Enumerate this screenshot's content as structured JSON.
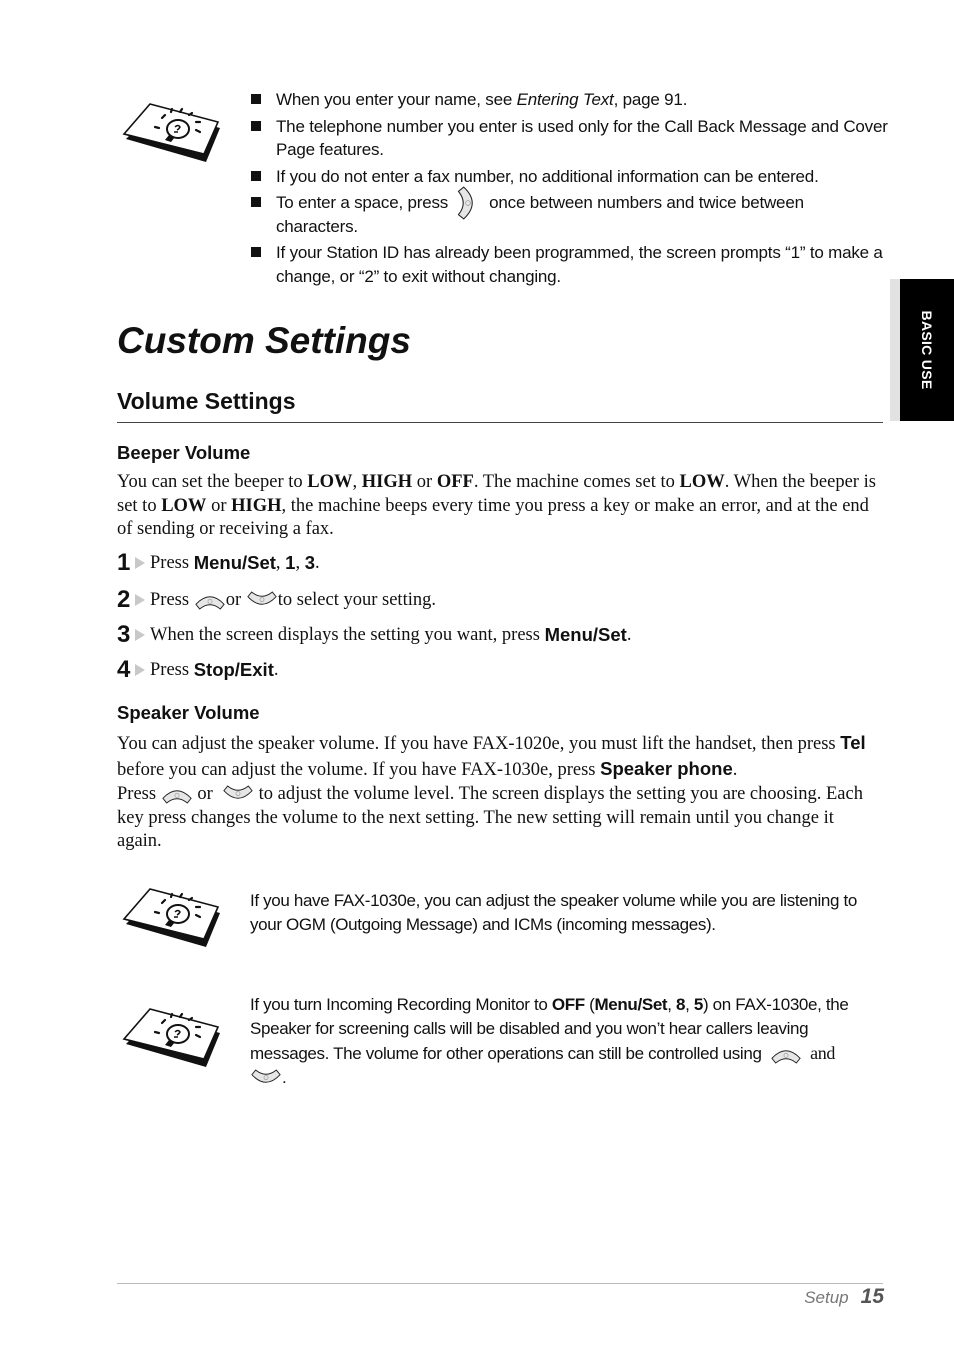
{
  "side_tab": {
    "label": "BASIC USE"
  },
  "notes_top": {
    "bullets": [
      {
        "pre": "When you enter your name, see ",
        "italic": "Entering Text",
        "post": ", page 91."
      },
      {
        "text": "The telephone number you enter is used only for the Call Back Message and Cover Page features."
      },
      {
        "text": "If you do not enter a fax number, no additional information can be entered."
      },
      {
        "pre": "To enter a space, press ",
        "post": " once between numbers and twice between characters."
      },
      {
        "text": "If your Station ID has already been programmed, the screen prompts “1” to make a change, or “2” to exit without changing."
      }
    ]
  },
  "page_title": "Custom Settings",
  "section": {
    "title": "Volume Settings",
    "beeper": {
      "title": "Beeper Volume",
      "intro": {
        "p1": "You can set the beeper to ",
        "low": "LOW",
        "c1": ", ",
        "high": "HIGH",
        "or": " or ",
        "off": "OFF",
        "p2": ". The machine comes set to ",
        "low2": "LOW",
        "p3": ". When the beeper is set to ",
        "low3": "LOW",
        "or2": " or ",
        "high2": "HIGH",
        "p4": ", the machine beeps every time you press a key or make an error, and at the end of sending or receiving a fax."
      },
      "steps": [
        {
          "num": "1",
          "pre": "Press ",
          "bold": "Menu/Set",
          "mid": ", ",
          "b2": "1",
          "mid2": ", ",
          "b3": "3",
          "post": "."
        },
        {
          "num": "2",
          "pre": "Press ",
          "or": " or ",
          "post": " to select your setting."
        },
        {
          "num": "3",
          "pre": "When the screen displays the setting you want, press ",
          "bold": "Menu/Set",
          "post": "."
        },
        {
          "num": "4",
          "pre": "Press ",
          "bold": "Stop/Exit",
          "post": "."
        }
      ]
    },
    "speaker": {
      "title": "Speaker Volume",
      "p1": {
        "a": "You can adjust the speaker volume. If you have FAX-1020e, you must lift the handset, then press ",
        "tel": "Tel",
        "b": " before you can adjust the volume. If you have FAX-1030e, press ",
        "spk": "Speaker phone",
        "c": "."
      },
      "p2": {
        "a": "Press ",
        "or": " or ",
        "b": " to adjust the volume level. The screen displays the setting you are choosing. Each key press changes the volume to the next setting. The new setting will remain until you change it again."
      }
    }
  },
  "tips": [
    {
      "text": "If you have FAX-1030e, you can adjust the speaker volume while you are listening to your OGM (Outgoing Message) and ICMs (incoming messages)."
    },
    {
      "a": "If you turn Incoming Recording Monitor to ",
      "off": "OFF",
      "b": " (",
      "menu": "Menu/Set",
      "c": ", ",
      "n8": "8",
      "d": ", ",
      "n5": "5",
      "e": ") on FAX-1030e, the Speaker for screening calls will be disabled and you won’t hear callers leaving messages. The volume for other operations can still be controlled using ",
      "and": " and",
      "end": "."
    }
  ],
  "footer": {
    "section": "Setup",
    "page": "15"
  }
}
